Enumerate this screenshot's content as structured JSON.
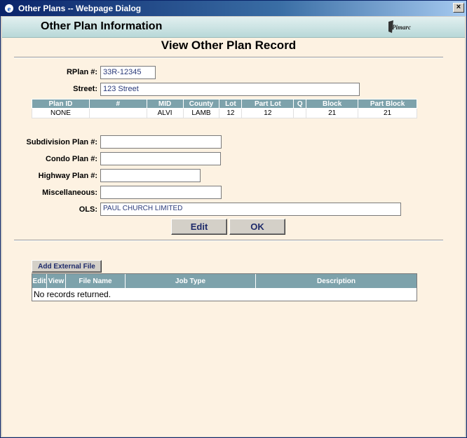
{
  "window": {
    "title": "Other Plans -- Webpage Dialog",
    "close_label": "×"
  },
  "header": {
    "title": "Other Plan Information",
    "logo_text": "Pimarc"
  },
  "page": {
    "heading": "View Other Plan Record"
  },
  "form": {
    "rplan_label": "RPlan #:",
    "rplan_value": "33R-12345",
    "street_label": "Street:",
    "street_value": "123 Street",
    "subdivision_label": "Subdivision Plan #:",
    "subdivision_value": "",
    "condo_label": "Condo Plan #:",
    "condo_value": "",
    "highway_label": "Highway Plan #:",
    "highway_value": "",
    "misc_label": "Miscellaneous:",
    "misc_value": "",
    "ols_label": "OLS:",
    "ols_value": "PAUL CHURCH LIMITED"
  },
  "plan_table": {
    "headers": [
      "Plan ID",
      "#",
      "MID",
      "County",
      "Lot",
      "Part Lot",
      "Q",
      "Block",
      "Part Block"
    ],
    "rows": [
      [
        "NONE",
        "",
        "ALVI",
        "LAMB",
        "12",
        "12",
        "",
        "21",
        "21"
      ]
    ]
  },
  "buttons": {
    "edit": "Edit",
    "ok": "OK",
    "add_external_file": "Add External File"
  },
  "files_table": {
    "headers": [
      "Edit",
      "View",
      "File Name",
      "Job Type",
      "Description"
    ],
    "empty_text": "No records returned."
  }
}
